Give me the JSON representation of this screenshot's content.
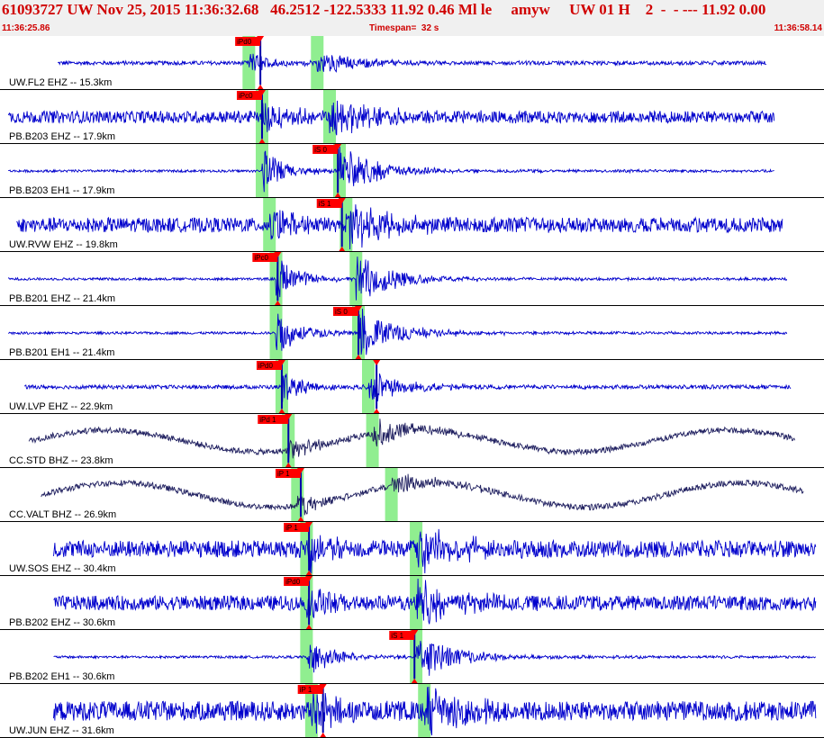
{
  "header": {
    "title": "61093727 UW Nov 25, 2015 11:36:32.68   46.2512 -122.5333 11.92 0.46 Ml le     amyw     UW 01 H    2  -  - --- 11.92 0.00",
    "start_time": "11:36:25.86",
    "timespan": "Timespan=  32 s",
    "end_time": "11:36:58.14"
  },
  "colors": {
    "title_red": "#d00000",
    "trace_blue": "#0000cc",
    "trace_dark": "#202060",
    "pick_window": "#90ee90",
    "pick_marker": "#ff0000",
    "separator": "#000000"
  },
  "channels": [
    {
      "label": "UW.FL2 EHZ -- 15.3km",
      "start": 0.07,
      "end": 0.93,
      "pwin": 0.302,
      "swin": 0.385,
      "picks": [
        {
          "text": "iPd0",
          "t": 0.316
        }
      ],
      "amp": 0.3,
      "noise": 0.08,
      "trace": "blue",
      "long": 0
    },
    {
      "label": "PB.B203 EHZ -- 17.9km",
      "start": 0.01,
      "end": 0.94,
      "pwin": 0.318,
      "swin": 0.4,
      "picks": [
        {
          "text": "iPc0",
          "t": 0.318
        }
      ],
      "amp": 0.5,
      "noise": 0.25,
      "trace": "blue",
      "long": 0
    },
    {
      "label": "PB.B203 EH1 -- 17.9km",
      "start": 0.01,
      "end": 0.94,
      "pwin": 0.318,
      "swin": 0.412,
      "picks": [
        {
          "text": "iS 0",
          "t": 0.41
        }
      ],
      "amp": 0.6,
      "noise": 0.05,
      "trace": "blue",
      "long": 0
    },
    {
      "label": "UW.RVW EHZ -- 19.8km",
      "start": 0.02,
      "end": 0.95,
      "pwin": 0.327,
      "swin": 0.42,
      "picks": [
        {
          "text": "iS 1",
          "t": 0.415
        }
      ],
      "amp": 0.55,
      "noise": 0.3,
      "trace": "blue",
      "long": 0
    },
    {
      "label": "PB.B201 EHZ -- 21.4km",
      "start": 0.01,
      "end": 0.955,
      "pwin": 0.335,
      "swin": 0.432,
      "picks": [
        {
          "text": "iPc0",
          "t": 0.337
        }
      ],
      "amp": 0.6,
      "noise": 0.05,
      "trace": "blue",
      "long": 0
    },
    {
      "label": "PB.B201 EH1 -- 21.4km",
      "start": 0.01,
      "end": 0.955,
      "pwin": 0.335,
      "swin": 0.435,
      "picks": [
        {
          "text": "iS 0",
          "t": 0.435
        }
      ],
      "amp": 0.6,
      "noise": 0.05,
      "trace": "blue",
      "long": 0
    },
    {
      "label": "UW.LVP EHZ -- 22.9km",
      "start": 0.03,
      "end": 0.96,
      "pwin": 0.342,
      "swin": 0.447,
      "picks": [
        {
          "text": "iPd0",
          "t": 0.342
        },
        {
          "text": "",
          "t": 0.457
        }
      ],
      "amp": 0.4,
      "noise": 0.08,
      "trace": "blue",
      "long": 0
    },
    {
      "label": "CC.STD BHZ -- 23.8km",
      "start": 0.035,
      "end": 0.965,
      "pwin": 0.35,
      "swin": 0.452,
      "picks": [
        {
          "text": "iPd 1",
          "t": 0.35
        }
      ],
      "amp": 0.35,
      "noise": 0.12,
      "trace": "dark",
      "long": 0.45
    },
    {
      "label": "CC.VALT BHZ -- 26.9km",
      "start": 0.05,
      "end": 0.975,
      "pwin": 0.361,
      "swin": 0.475,
      "picks": [
        {
          "text": "iP 1",
          "t": 0.365
        }
      ],
      "amp": 0.3,
      "noise": 0.12,
      "trace": "dark",
      "long": 0.5
    },
    {
      "label": "UW.SOS EHZ -- 30.4km",
      "start": 0.065,
      "end": 0.99,
      "pwin": 0.372,
      "swin": 0.505,
      "picks": [
        {
          "text": "iP 1",
          "t": 0.375
        }
      ],
      "amp": 0.55,
      "noise": 0.35,
      "trace": "blue",
      "long": 0
    },
    {
      "label": "PB.B202 EHZ -- 30.6km",
      "start": 0.065,
      "end": 0.99,
      "pwin": 0.372,
      "swin": 0.505,
      "picks": [
        {
          "text": "iPd0",
          "t": 0.375
        }
      ],
      "amp": 0.55,
      "noise": 0.3,
      "trace": "blue",
      "long": 0
    },
    {
      "label": "PB.B202 EH1 -- 30.6km",
      "start": 0.065,
      "end": 0.99,
      "pwin": 0.372,
      "swin": 0.505,
      "picks": [
        {
          "text": "iS 1",
          "t": 0.503
        }
      ],
      "amp": 0.6,
      "noise": 0.05,
      "trace": "blue",
      "long": 0
    },
    {
      "label": "UW.JUN EHZ -- 31.6km",
      "start": 0.065,
      "end": 0.99,
      "pwin": 0.378,
      "swin": 0.515,
      "picks": [
        {
          "text": "iP 1",
          "t": 0.392
        }
      ],
      "amp": 0.55,
      "noise": 0.4,
      "trace": "blue",
      "long": 0
    }
  ]
}
